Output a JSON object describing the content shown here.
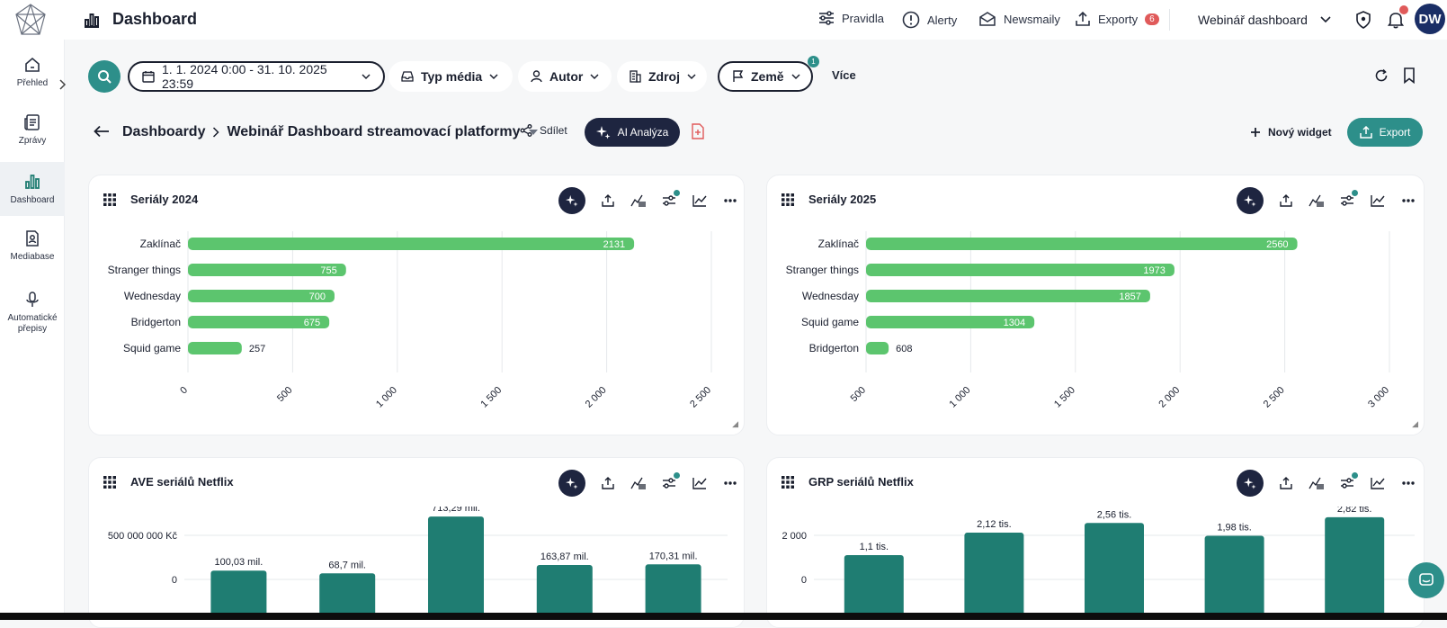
{
  "header": {
    "title": "Dashboard",
    "nav": [
      {
        "label": "Pravidla",
        "icon": "sliders-icon"
      },
      {
        "label": "Alerty",
        "icon": "alert-icon"
      },
      {
        "label": "Newsmaily",
        "icon": "mail-icon"
      },
      {
        "label": "Exporty",
        "icon": "upload-icon",
        "badge": "6"
      }
    ],
    "dashboard_select": "Webinář dashboard",
    "avatar": "DW"
  },
  "sidebar": {
    "items": [
      {
        "label": "Přehled",
        "icon": "home-icon",
        "active": false
      },
      {
        "label": "Zprávy",
        "icon": "news-icon",
        "active": false
      },
      {
        "label": "Dashboard",
        "icon": "bar-chart-icon",
        "active": true
      },
      {
        "label": "Mediabase",
        "icon": "mediabase-icon",
        "active": false
      },
      {
        "label": "Automatické přepisy",
        "icon": "microphone-icon",
        "active": false
      }
    ]
  },
  "filters": {
    "date_range": "1. 1. 2024 0:00 - 31. 10. 2025 23:59",
    "media_type": "Typ média",
    "author": "Autor",
    "source": "Zdroj",
    "country": "Země",
    "country_badge": "1",
    "more": "Více"
  },
  "breadcrumb": {
    "root": "Dashboardy",
    "current": "Webinář Dashboard streamovací platformy",
    "share": "Sdílet",
    "ai": "AI Analýza",
    "new_widget": "Nový widget",
    "export": "Export"
  },
  "widgets": [
    {
      "title": "Seriály 2024"
    },
    {
      "title": "Seriály 2025"
    },
    {
      "title": "AVE seriálů Netflix"
    },
    {
      "title": "GRP seriálů Netflix"
    }
  ],
  "colors": {
    "bar_green": "#5cc56e",
    "bar_teal": "#1f7d72",
    "accent": "#2d8f8a",
    "dark": "#1e2540"
  },
  "chart_data": [
    {
      "type": "bar",
      "orientation": "horizontal",
      "title": "Seriály 2024",
      "categories": [
        "Zaklínač",
        "Stranger things",
        "Wednesday",
        "Bridgerton",
        "Squid game"
      ],
      "values": [
        2131,
        755,
        700,
        675,
        257
      ],
      "value_labels": [
        "2131",
        "755",
        "700",
        "675",
        "257"
      ],
      "xlim": [
        0,
        2500
      ],
      "ticks": [
        "0",
        "500",
        "1 000",
        "1 500",
        "2 000",
        "2 500"
      ],
      "tick_values": [
        0,
        500,
        1000,
        1500,
        2000,
        2500
      ]
    },
    {
      "type": "bar",
      "orientation": "horizontal",
      "title": "Seriály 2025",
      "categories": [
        "Zaklínač",
        "Stranger things",
        "Wednesday",
        "Squid game",
        "Bridgerton"
      ],
      "values": [
        2560,
        1973,
        1857,
        1304,
        608
      ],
      "value_labels": [
        "2560",
        "1973",
        "1857",
        "1304",
        "608"
      ],
      "xlim": [
        500,
        3000
      ],
      "ticks": [
        "500",
        "1 000",
        "1 500",
        "2 000",
        "2 500",
        "3 000"
      ],
      "tick_values": [
        500,
        1000,
        1500,
        2000,
        2500,
        3000
      ]
    },
    {
      "type": "bar",
      "orientation": "vertical",
      "title": "AVE seriálů Netflix",
      "values": [
        100030000,
        68700000,
        713290000,
        163870000,
        170310000
      ],
      "value_labels": [
        "100,03 mil.",
        "68,7 mil.",
        "713,29 mil.",
        "163,87 mil.",
        "170,31 mil."
      ],
      "y_ticks": [
        "0",
        "500 000 000 Kč"
      ],
      "y_tick_values": [
        0,
        500000000
      ]
    },
    {
      "type": "bar",
      "orientation": "vertical",
      "title": "GRP seriálů Netflix",
      "values": [
        1100,
        2120,
        2560,
        1980,
        2820
      ],
      "value_labels": [
        "1,1 tis.",
        "2,12 tis.",
        "2,56 tis.",
        "1,98 tis.",
        "2,82 tis."
      ],
      "y_ticks": [
        "0",
        "2 000"
      ],
      "y_tick_values": [
        0,
        2000
      ]
    }
  ]
}
